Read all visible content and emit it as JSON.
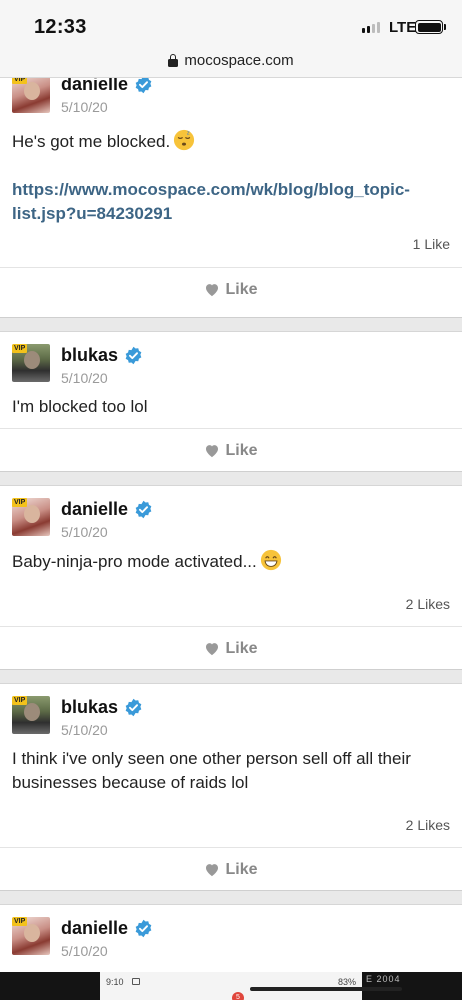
{
  "status_bar": {
    "time": "12:33",
    "network": "LTE"
  },
  "browser": {
    "url": "mocospace.com"
  },
  "posts": [
    {
      "author": "danielle",
      "date": "5/10/20",
      "text": "He's got me blocked.",
      "emoji": "sleepy-face-emoji",
      "link": "https://www.mocospace.com/wk/blog/blog_topic-list.jsp?u=84230291",
      "likes": "1 Like",
      "like_button": "Like"
    },
    {
      "author": "blukas",
      "date": "5/10/20",
      "text": "I'm blocked too lol",
      "like_button": "Like"
    },
    {
      "author": "danielle",
      "date": "5/10/20",
      "text": "Baby-ninja-pro mode activated...",
      "emoji": "grinning-face-emoji",
      "likes": "2 Likes",
      "like_button": "Like"
    },
    {
      "author": "blukas",
      "date": "5/10/20",
      "text": "I think i've only seen one other person sell off all their businesses because of raids lol",
      "likes": "2 Likes",
      "like_button": "Like"
    },
    {
      "author": "danielle",
      "date": "5/10/20"
    }
  ],
  "avatar_badge": "VIP",
  "bottom_overlay": {
    "time": "9:10",
    "battery": "83%",
    "badge_count": "5",
    "side_text": "E 2004"
  },
  "colors": {
    "link": "#3d6585",
    "verified": "#3a9ad9",
    "like_gray": "#888888"
  }
}
